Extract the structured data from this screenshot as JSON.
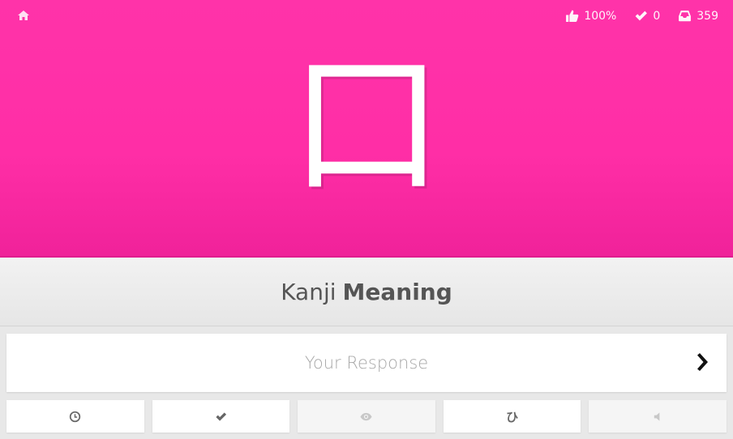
{
  "header": {
    "home_icon": "home-icon",
    "stats": {
      "percent_correct": "100%",
      "completed": "0",
      "remaining": "359"
    }
  },
  "character": {
    "kanji": "口",
    "background": "#ff2ea6"
  },
  "question": {
    "type_prefix": "Kanji",
    "type_bold": "Meaning"
  },
  "answer": {
    "placeholder": "Your Response",
    "value": ""
  },
  "actions": [
    {
      "icon": "clock-icon",
      "enabled": true
    },
    {
      "icon": "check-icon",
      "enabled": true
    },
    {
      "icon": "eye-icon",
      "enabled": false
    },
    {
      "icon": "hiragana-icon",
      "label": "ひ",
      "enabled": true
    },
    {
      "icon": "audio-icon",
      "enabled": false
    }
  ]
}
